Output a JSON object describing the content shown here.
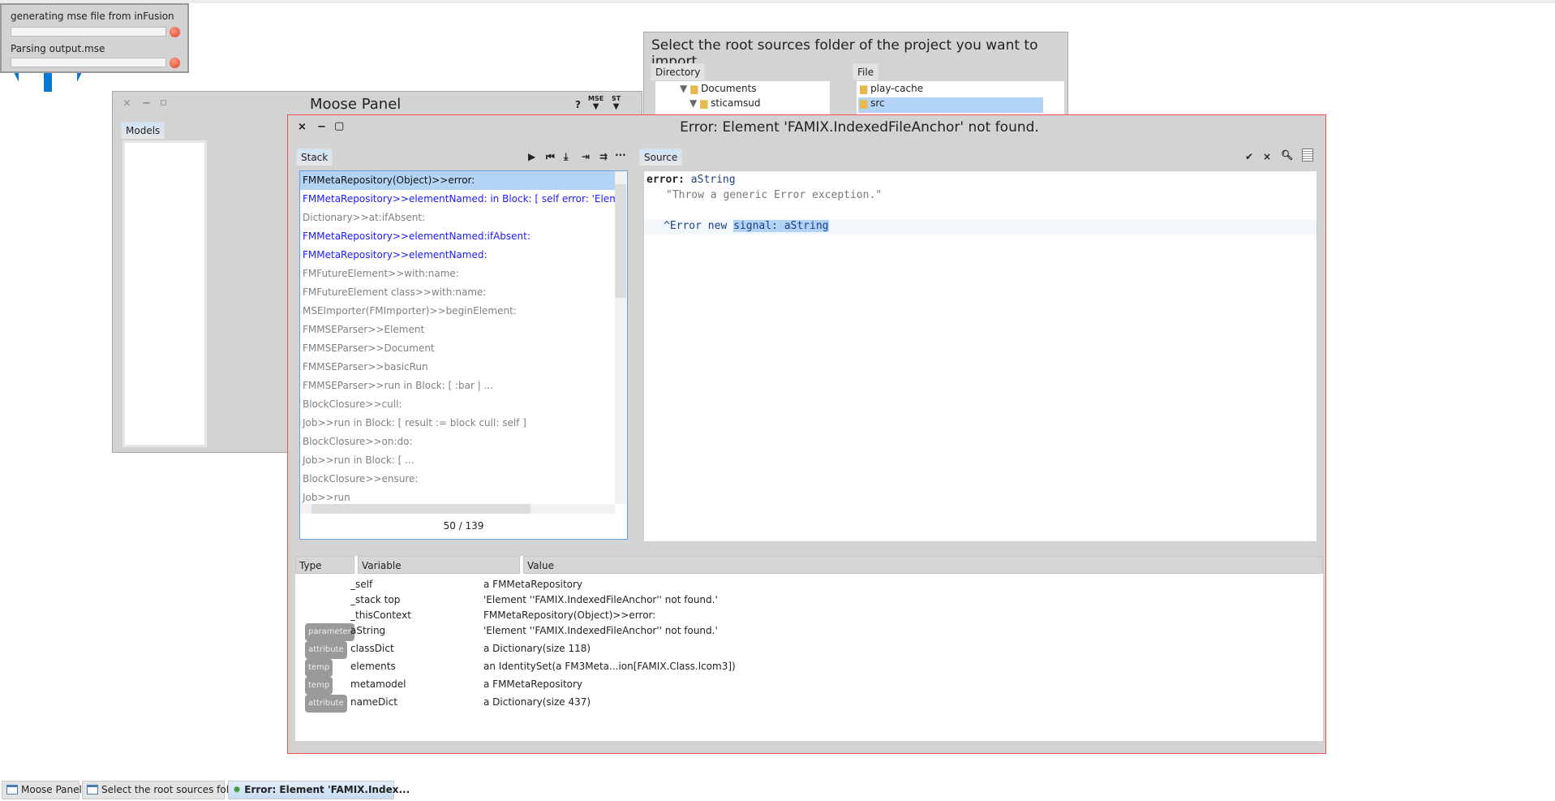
{
  "progress": {
    "items": [
      {
        "label": "generating mse file from inFusion",
        "progress": 0
      },
      {
        "label": "Parsing output.mse",
        "progress": 0
      }
    ]
  },
  "moose_panel": {
    "title": "Moose Panel",
    "tab": "Models",
    "toolbar": {
      "help": "?",
      "mse": "MSE",
      "st": "ST",
      "more": "···"
    }
  },
  "import_dialog": {
    "title": "Select the root sources folder of the project you want to import",
    "directory_tab": "Directory",
    "file_tab": "File",
    "directories": [
      "Documents",
      "sticamsud"
    ],
    "files": [
      "play-cache",
      "src"
    ],
    "selected_file": "src"
  },
  "debugger": {
    "title": "Error: Element 'FAMIX.IndexedFileAnchor' not found.",
    "stack_tab": "Stack",
    "source_tab": "Source",
    "stack": [
      {
        "text": "FMMetaRepository(Object)>>error:",
        "kind": "selected"
      },
      {
        "text": "FMMetaRepository>>elementNamed: in Block: [ self error: 'Element ''' , ",
        "kind": "blue"
      },
      {
        "text": "Dictionary>>at:ifAbsent:",
        "kind": "gray"
      },
      {
        "text": "FMMetaRepository>>elementNamed:ifAbsent:",
        "kind": "blue"
      },
      {
        "text": "FMMetaRepository>>elementNamed:",
        "kind": "blue"
      },
      {
        "text": "FMFutureElement>>with:name:",
        "kind": "gray"
      },
      {
        "text": "FMFutureElement class>>with:name:",
        "kind": "gray"
      },
      {
        "text": "MSEImporter(FMImporter)>>beginElement:",
        "kind": "gray"
      },
      {
        "text": "FMMSEParser>>Element",
        "kind": "gray"
      },
      {
        "text": "FMMSEParser>>Document",
        "kind": "gray"
      },
      {
        "text": "FMMSEParser>>basicRun",
        "kind": "gray"
      },
      {
        "text": "FMMSEParser>>run in Block: [ :bar | ...",
        "kind": "gray"
      },
      {
        "text": "BlockClosure>>cull:",
        "kind": "gray"
      },
      {
        "text": "Job>>run in Block: [ result := block cull: self ]",
        "kind": "gray"
      },
      {
        "text": "BlockClosure>>on:do:",
        "kind": "gray"
      },
      {
        "text": "Job>>run in Block: [ ...",
        "kind": "gray"
      },
      {
        "text": "BlockClosure>>ensure:",
        "kind": "gray"
      },
      {
        "text": "Job>>run",
        "kind": "gray"
      }
    ],
    "stack_counter": "50 / 139",
    "source": {
      "selector": "error:",
      "arg": "aString",
      "comment": "\"Throw a generic Error exception.\"",
      "line_pre": "^Error new ",
      "line_sel": "signal: aString"
    },
    "inspector": {
      "columns": [
        "Type",
        "Variable",
        "Value"
      ],
      "rows": [
        {
          "type": "",
          "variable": "_self",
          "value": "a FMMetaRepository"
        },
        {
          "type": "",
          "variable": "_stack top",
          "value": "'Element ''FAMIX.IndexedFileAnchor'' not found.'"
        },
        {
          "type": "",
          "variable": "_thisContext",
          "value": "FMMetaRepository(Object)>>error:"
        },
        {
          "type": "parameter",
          "variable": "aString",
          "value": "'Element ''FAMIX.IndexedFileAnchor'' not found.'"
        },
        {
          "type": "attribute",
          "variable": "classDict",
          "value": "a Dictionary(size 118)"
        },
        {
          "type": "temp",
          "variable": "elements",
          "value": "an IdentitySet(a FM3Meta...ion[FAMIX.Class.lcom3])"
        },
        {
          "type": "temp",
          "variable": "metamodel",
          "value": "a FMMetaRepository"
        },
        {
          "type": "attribute",
          "variable": "nameDict",
          "value": "a Dictionary(size 437)"
        }
      ]
    }
  },
  "taskbar": [
    {
      "label": "Moose Panel",
      "icon": "window-icon"
    },
    {
      "label": "Select the root sources fol...",
      "icon": "window-icon"
    },
    {
      "label": "Error: Element 'FAMIX.Index...",
      "icon": "bug-icon",
      "active": true
    }
  ],
  "colors": {
    "accent": "#0078d7",
    "selection": "#b3d4f5",
    "link_blue": "#1a1aff",
    "error_border": "#f05050"
  }
}
